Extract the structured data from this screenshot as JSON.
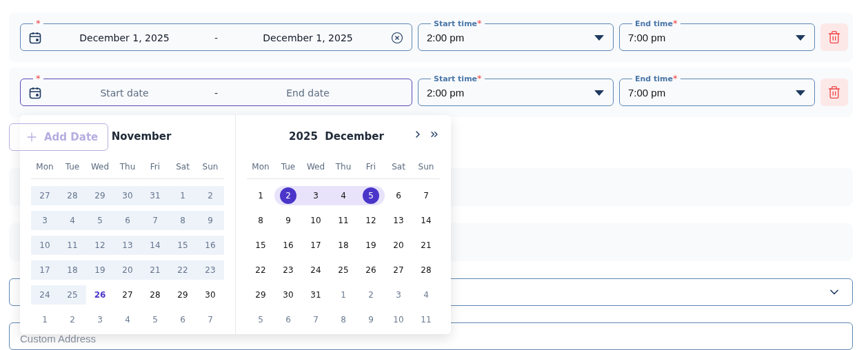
{
  "rows": [
    {
      "date": {
        "required": "*",
        "start": "December 1, 2025",
        "end": "December 1, 2025",
        "separator": "-",
        "clearable": true,
        "focused": false
      },
      "start_time": {
        "label": "Start time",
        "required": "*",
        "value": "2:00 pm"
      },
      "end_time": {
        "label": "End time",
        "required": "*",
        "value": "7:00 pm"
      }
    },
    {
      "date": {
        "required": "*",
        "start_placeholder": "Start date",
        "end_placeholder": "End date",
        "separator": "-",
        "focused": true
      },
      "start_time": {
        "label": "Start time",
        "required": "*",
        "value": "2:00 pm"
      },
      "end_time": {
        "label": "End time",
        "required": "*",
        "value": "7:00 pm"
      }
    }
  ],
  "add_date": {
    "label": "Add Date"
  },
  "address": {
    "placeholder": "Custom Address"
  },
  "date_picker": {
    "panels": [
      {
        "title": "November",
        "weekdays": [
          "Mon",
          "Tue",
          "Wed",
          "Thu",
          "Fri",
          "Sat",
          "Sun"
        ],
        "weeks": [
          [
            {
              "label": "27",
              "kind": "disabled",
              "today": false,
              "selected": false,
              "in_range": false
            },
            {
              "label": "28",
              "kind": "disabled",
              "today": false,
              "selected": false,
              "in_range": false
            },
            {
              "label": "29",
              "kind": "disabled",
              "today": false,
              "selected": false,
              "in_range": false
            },
            {
              "label": "30",
              "kind": "disabled",
              "today": false,
              "selected": false,
              "in_range": false
            },
            {
              "label": "31",
              "kind": "disabled",
              "today": false,
              "selected": false,
              "in_range": false
            },
            {
              "label": "1",
              "kind": "disabled",
              "today": false,
              "selected": false,
              "in_range": false
            },
            {
              "label": "2",
              "kind": "disabled",
              "today": false,
              "selected": false,
              "in_range": false
            }
          ],
          [
            {
              "label": "3",
              "kind": "disabled",
              "today": false,
              "selected": false,
              "in_range": false
            },
            {
              "label": "4",
              "kind": "disabled",
              "today": false,
              "selected": false,
              "in_range": false
            },
            {
              "label": "5",
              "kind": "disabled",
              "today": false,
              "selected": false,
              "in_range": false
            },
            {
              "label": "6",
              "kind": "disabled",
              "today": false,
              "selected": false,
              "in_range": false
            },
            {
              "label": "7",
              "kind": "disabled",
              "today": false,
              "selected": false,
              "in_range": false
            },
            {
              "label": "8",
              "kind": "disabled",
              "today": false,
              "selected": false,
              "in_range": false
            },
            {
              "label": "9",
              "kind": "disabled",
              "today": false,
              "selected": false,
              "in_range": false
            }
          ],
          [
            {
              "label": "10",
              "kind": "disabled",
              "today": false,
              "selected": false,
              "in_range": false
            },
            {
              "label": "11",
              "kind": "disabled",
              "today": false,
              "selected": false,
              "in_range": false
            },
            {
              "label": "12",
              "kind": "disabled",
              "today": false,
              "selected": false,
              "in_range": false
            },
            {
              "label": "13",
              "kind": "disabled",
              "today": false,
              "selected": false,
              "in_range": false
            },
            {
              "label": "14",
              "kind": "disabled",
              "today": false,
              "selected": false,
              "in_range": false
            },
            {
              "label": "15",
              "kind": "disabled",
              "today": false,
              "selected": false,
              "in_range": false
            },
            {
              "label": "16",
              "kind": "disabled",
              "today": false,
              "selected": false,
              "in_range": false
            }
          ],
          [
            {
              "label": "17",
              "kind": "disabled",
              "today": false,
              "selected": false,
              "in_range": false
            },
            {
              "label": "18",
              "kind": "disabled",
              "today": false,
              "selected": false,
              "in_range": false
            },
            {
              "label": "19",
              "kind": "disabled",
              "today": false,
              "selected": false,
              "in_range": false
            },
            {
              "label": "20",
              "kind": "disabled",
              "today": false,
              "selected": false,
              "in_range": false
            },
            {
              "label": "21",
              "kind": "disabled",
              "today": false,
              "selected": false,
              "in_range": false
            },
            {
              "label": "22",
              "kind": "disabled",
              "today": false,
              "selected": false,
              "in_range": false
            },
            {
              "label": "23",
              "kind": "disabled",
              "today": false,
              "selected": false,
              "in_range": false
            }
          ],
          [
            {
              "label": "24",
              "kind": "disabled",
              "today": false,
              "selected": false,
              "in_range": false
            },
            {
              "label": "25",
              "kind": "disabled",
              "today": false,
              "selected": false,
              "in_range": false
            },
            {
              "label": "26",
              "kind": "normal",
              "today": true,
              "selected": false,
              "in_range": false
            },
            {
              "label": "27",
              "kind": "normal",
              "today": false,
              "selected": false,
              "in_range": false
            },
            {
              "label": "28",
              "kind": "normal",
              "today": false,
              "selected": false,
              "in_range": false
            },
            {
              "label": "29",
              "kind": "normal",
              "today": false,
              "selected": false,
              "in_range": false
            },
            {
              "label": "30",
              "kind": "normal",
              "today": false,
              "selected": false,
              "in_range": false
            }
          ],
          [
            {
              "label": "1",
              "kind": "outside",
              "today": false,
              "selected": false,
              "in_range": false
            },
            {
              "label": "2",
              "kind": "outside",
              "today": false,
              "selected": false,
              "in_range": false
            },
            {
              "label": "3",
              "kind": "outside",
              "today": false,
              "selected": false,
              "in_range": false
            },
            {
              "label": "4",
              "kind": "outside",
              "today": false,
              "selected": false,
              "in_range": false
            },
            {
              "label": "5",
              "kind": "outside",
              "today": false,
              "selected": false,
              "in_range": false
            },
            {
              "label": "6",
              "kind": "outside",
              "today": false,
              "selected": false,
              "in_range": false
            },
            {
              "label": "7",
              "kind": "outside",
              "today": false,
              "selected": false,
              "in_range": false
            }
          ]
        ]
      },
      {
        "title": "2025  December",
        "nav": true,
        "weekdays": [
          "Mon",
          "Tue",
          "Wed",
          "Thu",
          "Fri",
          "Sat",
          "Sun"
        ],
        "weeks": [
          [
            {
              "label": "1",
              "kind": "normal",
              "today": false,
              "selected": false,
              "in_range": false
            },
            {
              "label": "2",
              "kind": "normal",
              "today": false,
              "selected": true,
              "in_range": true
            },
            {
              "label": "3",
              "kind": "normal",
              "today": false,
              "selected": false,
              "in_range": true
            },
            {
              "label": "4",
              "kind": "normal",
              "today": false,
              "selected": false,
              "in_range": true
            },
            {
              "label": "5",
              "kind": "normal",
              "today": false,
              "selected": true,
              "in_range": true
            },
            {
              "label": "6",
              "kind": "normal",
              "today": false,
              "selected": false,
              "in_range": false
            },
            {
              "label": "7",
              "kind": "normal",
              "today": false,
              "selected": false,
              "in_range": false
            }
          ],
          [
            {
              "label": "8",
              "kind": "normal",
              "today": false,
              "selected": false,
              "in_range": false
            },
            {
              "label": "9",
              "kind": "normal",
              "today": false,
              "selected": false,
              "in_range": false
            },
            {
              "label": "10",
              "kind": "normal",
              "today": false,
              "selected": false,
              "in_range": false
            },
            {
              "label": "11",
              "kind": "normal",
              "today": false,
              "selected": false,
              "in_range": false
            },
            {
              "label": "12",
              "kind": "normal",
              "today": false,
              "selected": false,
              "in_range": false
            },
            {
              "label": "13",
              "kind": "normal",
              "today": false,
              "selected": false,
              "in_range": false
            },
            {
              "label": "14",
              "kind": "normal",
              "today": false,
              "selected": false,
              "in_range": false
            }
          ],
          [
            {
              "label": "15",
              "kind": "normal",
              "today": false,
              "selected": false,
              "in_range": false
            },
            {
              "label": "16",
              "kind": "normal",
              "today": false,
              "selected": false,
              "in_range": false
            },
            {
              "label": "17",
              "kind": "normal",
              "today": false,
              "selected": false,
              "in_range": false
            },
            {
              "label": "18",
              "kind": "normal",
              "today": false,
              "selected": false,
              "in_range": false
            },
            {
              "label": "19",
              "kind": "normal",
              "today": false,
              "selected": false,
              "in_range": false
            },
            {
              "label": "20",
              "kind": "normal",
              "today": false,
              "selected": false,
              "in_range": false
            },
            {
              "label": "21",
              "kind": "normal",
              "today": false,
              "selected": false,
              "in_range": false
            }
          ],
          [
            {
              "label": "22",
              "kind": "normal",
              "today": false,
              "selected": false,
              "in_range": false
            },
            {
              "label": "23",
              "kind": "normal",
              "today": false,
              "selected": false,
              "in_range": false
            },
            {
              "label": "24",
              "kind": "normal",
              "today": false,
              "selected": false,
              "in_range": false
            },
            {
              "label": "25",
              "kind": "normal",
              "today": false,
              "selected": false,
              "in_range": false
            },
            {
              "label": "26",
              "kind": "normal",
              "today": false,
              "selected": false,
              "in_range": false
            },
            {
              "label": "27",
              "kind": "normal",
              "today": false,
              "selected": false,
              "in_range": false
            },
            {
              "label": "28",
              "kind": "normal",
              "today": false,
              "selected": false,
              "in_range": false
            }
          ],
          [
            {
              "label": "29",
              "kind": "normal",
              "today": false,
              "selected": false,
              "in_range": false
            },
            {
              "label": "30",
              "kind": "normal",
              "today": false,
              "selected": false,
              "in_range": false
            },
            {
              "label": "31",
              "kind": "normal",
              "today": false,
              "selected": false,
              "in_range": false
            },
            {
              "label": "1",
              "kind": "outside",
              "today": false,
              "selected": false,
              "in_range": false
            },
            {
              "label": "2",
              "kind": "outside",
              "today": false,
              "selected": false,
              "in_range": false
            },
            {
              "label": "3",
              "kind": "outside",
              "today": false,
              "selected": false,
              "in_range": false
            },
            {
              "label": "4",
              "kind": "outside",
              "today": false,
              "selected": false,
              "in_range": false
            }
          ],
          [
            {
              "label": "5",
              "kind": "outside",
              "today": false,
              "selected": false,
              "in_range": false
            },
            {
              "label": "6",
              "kind": "outside",
              "today": false,
              "selected": false,
              "in_range": false
            },
            {
              "label": "7",
              "kind": "outside",
              "today": false,
              "selected": false,
              "in_range": false
            },
            {
              "label": "8",
              "kind": "outside",
              "today": false,
              "selected": false,
              "in_range": false
            },
            {
              "label": "9",
              "kind": "outside",
              "today": false,
              "selected": false,
              "in_range": false
            },
            {
              "label": "10",
              "kind": "outside",
              "today": false,
              "selected": false,
              "in_range": false
            },
            {
              "label": "11",
              "kind": "outside",
              "today": false,
              "selected": false,
              "in_range": false
            }
          ]
        ]
      }
    ]
  }
}
